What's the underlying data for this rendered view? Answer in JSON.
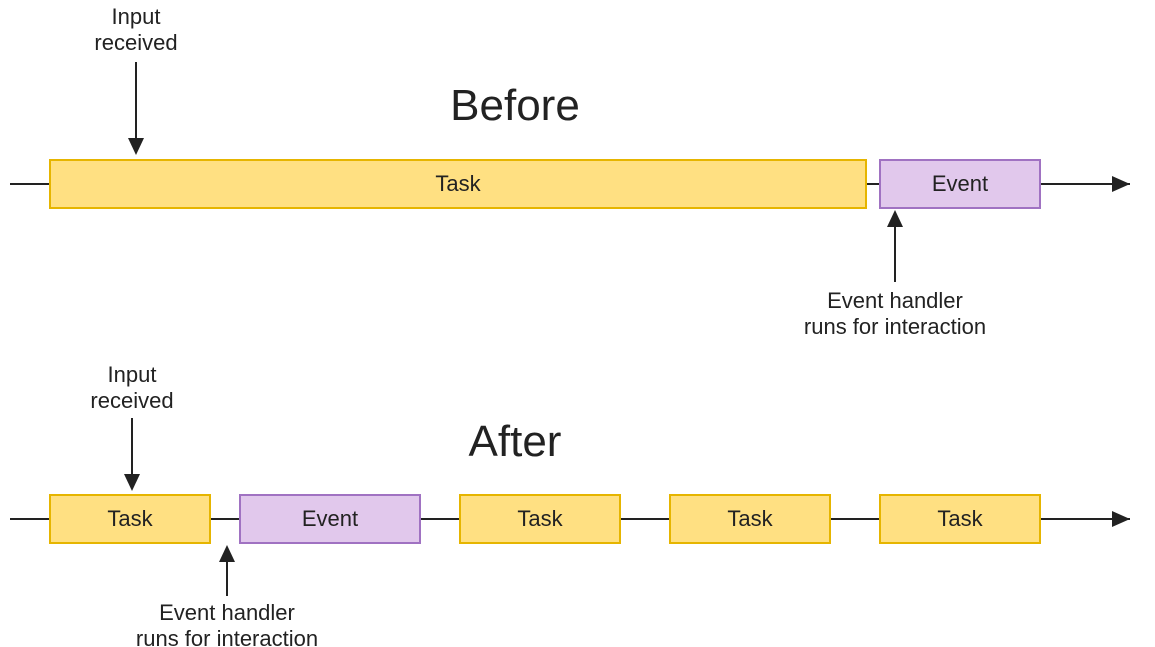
{
  "colors": {
    "task_fill": "#ffe082",
    "task_stroke": "#e6b500",
    "event_fill": "#e1c8ec",
    "event_stroke": "#a072c2"
  },
  "before": {
    "title": "Before",
    "input_label_l1": "Input",
    "input_label_l2": "received",
    "handler_label_l1": "Event handler",
    "handler_label_l2": "runs for interaction",
    "blocks": [
      {
        "kind": "task",
        "label": "Task"
      },
      {
        "kind": "event",
        "label": "Event"
      }
    ]
  },
  "after": {
    "title": "After",
    "input_label_l1": "Input",
    "input_label_l2": "received",
    "handler_label_l1": "Event handler",
    "handler_label_l2": "runs for interaction",
    "blocks": [
      {
        "kind": "task",
        "label": "Task"
      },
      {
        "kind": "event",
        "label": "Event"
      },
      {
        "kind": "task",
        "label": "Task"
      },
      {
        "kind": "task",
        "label": "Task"
      },
      {
        "kind": "task",
        "label": "Task"
      }
    ]
  }
}
